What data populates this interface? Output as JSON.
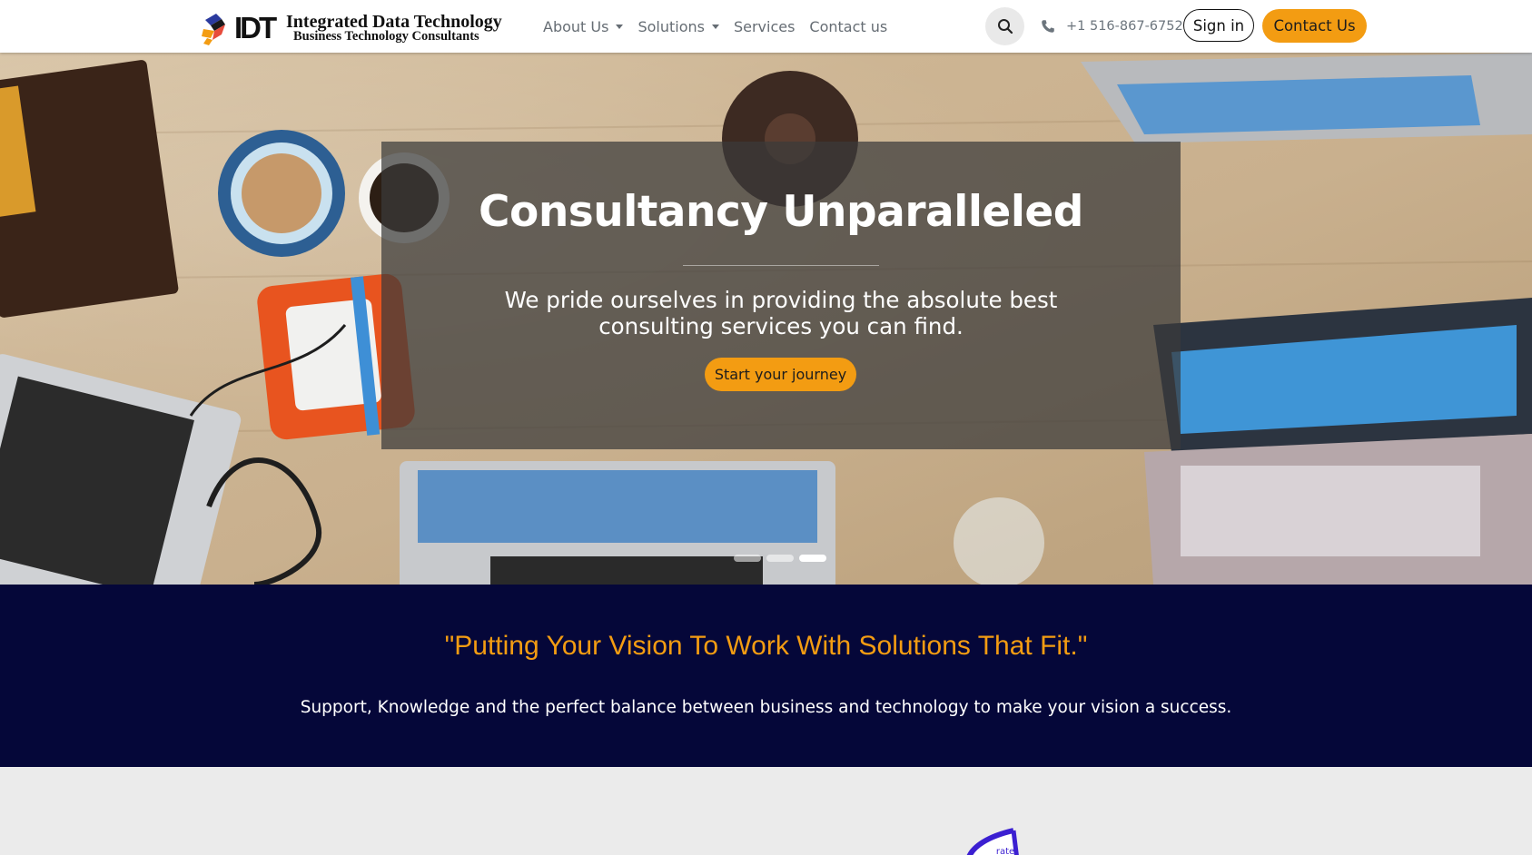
{
  "navbar": {
    "logo": {
      "mark_text": "IDT",
      "company_name": "Integrated Data Technology",
      "tagline": "Business Technology Consultants"
    },
    "menu": [
      {
        "label": "About Us",
        "has_dropdown": true
      },
      {
        "label": "Solutions",
        "has_dropdown": true
      },
      {
        "label": "Services",
        "has_dropdown": false
      },
      {
        "label": "Contact us",
        "has_dropdown": false
      }
    ],
    "search_icon": "search-icon",
    "phone": {
      "icon": "phone-icon",
      "number": "+1 516-867-6752"
    },
    "sign_in_label": "Sign in",
    "contact_label": "Contact Us"
  },
  "hero": {
    "title": "Consultancy Unparalleled",
    "subtitle_line1": "We pride ourselves in providing the absolute best",
    "subtitle_line2": "consulting services you can find.",
    "cta_label": "Start your journey",
    "carousel": {
      "slides": 3,
      "active_index": 2
    }
  },
  "banner": {
    "quote": "\"Putting Your Vision To Work With Solutions That Fit.\"",
    "text": "Support, Knowledge and the perfect balance between business and technology to make your vision a success."
  },
  "bottom_graphic": {
    "label": "rate"
  },
  "colors": {
    "accent": "#f39c12",
    "banner_bg": "#050739",
    "nav_text": "#666d74",
    "bottom_bg": "#ebebeb",
    "graphic_purple": "#3b1fd1"
  }
}
